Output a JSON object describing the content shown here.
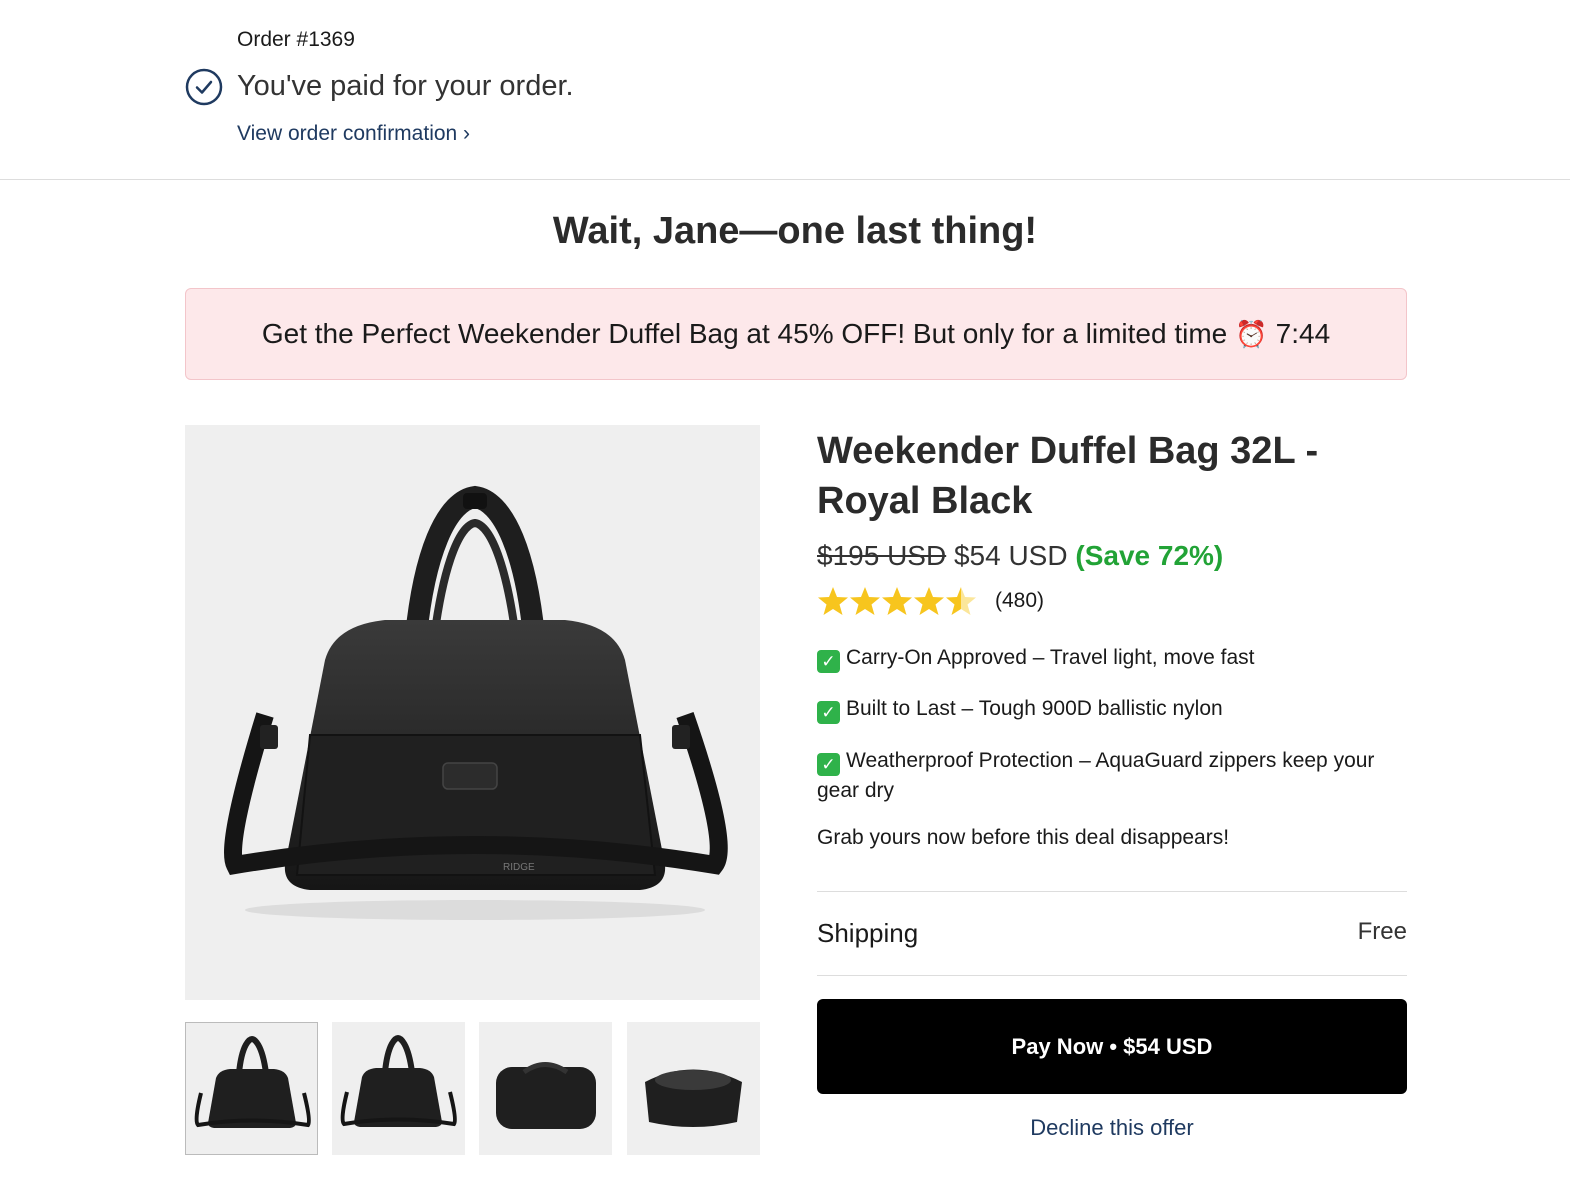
{
  "order": {
    "number_label": "Order #1369",
    "paid_title": "You've paid for your order.",
    "view_link": "View order confirmation ›"
  },
  "headline": "Wait, Jane—one last thing!",
  "banner": {
    "text": "Get the Perfect Weekender Duffel Bag at 45% OFF! But only for a limited time",
    "clock_icon": "⏰",
    "timer": "7:44"
  },
  "product": {
    "title": "Weekender Duffel Bag 32L - Royal Black",
    "original_price": "$195 USD",
    "price": "$54 USD",
    "savings": "(Save 72%)",
    "rating": 4.5,
    "review_count": "(480)",
    "features": [
      "Carry-On Approved – Travel light, move fast",
      "Built to Last – Tough 900D ballistic nylon",
      "Weatherproof Protection – AquaGuard zippers keep your gear dry"
    ],
    "call_to_action": "Grab yours now before this deal disappears!",
    "image_brand": "RIDGE",
    "thumbnails": [
      "front view",
      "angled view",
      "top view",
      "open interior view"
    ]
  },
  "shipping": {
    "label": "Shipping",
    "value": "Free"
  },
  "actions": {
    "pay_label": "Pay Now • $54 USD",
    "decline_label": "Decline this offer"
  },
  "colors": {
    "banner_bg": "#fde8ea",
    "save_green": "#22a336",
    "link_blue": "#1f3a60",
    "button_bg": "#000000",
    "star_gold": "#f7c51e"
  }
}
